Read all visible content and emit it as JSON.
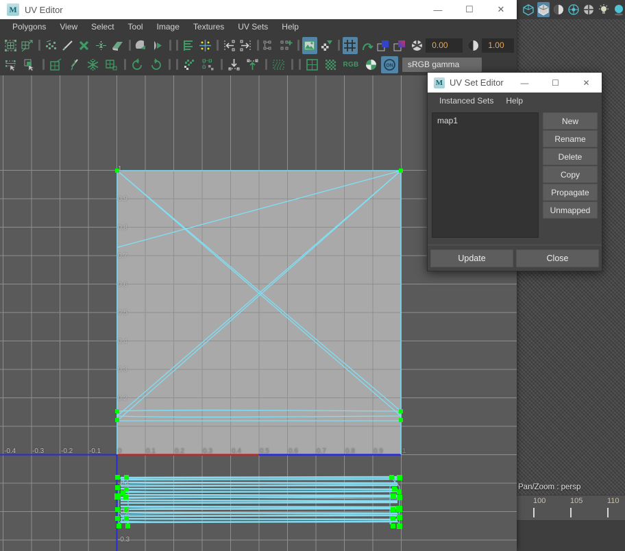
{
  "window": {
    "title": "UV Editor",
    "logo_letter": "M",
    "minimize": "—",
    "maximize": "☐",
    "close": "✕"
  },
  "menubar": {
    "items": [
      "Polygons",
      "View",
      "Select",
      "Tool",
      "Image",
      "Textures",
      "UV Sets",
      "Help"
    ]
  },
  "toolbar": {
    "row1_icons": [
      "uv-lattice-icon",
      "uv-grid-move-icon",
      "sep",
      "uv-smooth-icon",
      "uv-cut-tool-icon",
      "uv-cut-x-icon",
      "uv-sew-icon",
      "uv-unfold-icon",
      "sep",
      "uv-flip-icon",
      "uv-rotate-shell-icon",
      "sep",
      "uv-align-stack-icon",
      "uv-snap-together-icon",
      "sep",
      "uv-align-left-icon",
      "uv-align-right-icon"
    ],
    "row2_icons": [
      "uv-select-shell-icon",
      "uv-select-face-icon",
      "sep",
      "uv-create-icon",
      "uv-cut-uv-icon",
      "uv-unfold-snowflake-icon",
      "uv-layout-icon",
      "sep",
      "uv-undo-icon",
      "uv-redo-icon",
      "sep",
      "uv-distribute-icon",
      "uv-grid-arrange-icon",
      "sep",
      "uv-align-bottom-icon",
      "uv-align-top-icon"
    ],
    "display_toggle_icon": "image-display-icon",
    "checker_icon": "checker-filter-icon",
    "dim_image_icon": "dim-image-icon",
    "grid_icon": "uv-grid-icon",
    "distort_icon": "distortion-icon",
    "blue_swatch_icon": "solid-color-swatch-icon",
    "gradient_swatch_icon": "gradient-swatch-icon",
    "aperture_icon": "exposure-icon",
    "exposure_value": "0.00",
    "contrast_icon": "gamma-icon",
    "gamma_value": "1.00",
    "uv_border_icon": "uv-border-icon",
    "checker_pattern_icon": "checker-pattern-icon",
    "rgb_label": "RGB",
    "channel_icon": "channel-pie-icon",
    "on_toggle_icon": "on-toggle-icon",
    "color_space": "sRGB gamma"
  },
  "uv_set_editor": {
    "title": "UV Set Editor",
    "logo_letter": "M",
    "minimize": "—",
    "maximize": "☐",
    "close": "✕",
    "menu": [
      "Instanced Sets",
      "Help"
    ],
    "sets": [
      "map1"
    ],
    "side_buttons": [
      "New",
      "Rename",
      "Delete",
      "Copy",
      "Propagate",
      "Unmapped"
    ],
    "footer_buttons": [
      "Update",
      "Close"
    ]
  },
  "uv_canvas": {
    "u_ticks": [
      "0",
      "0.1",
      "0.2",
      "0.3",
      "0.4",
      "0.5",
      "0.6",
      "0.7",
      "0.8",
      "0.9",
      "1"
    ],
    "u_ticks_left": [
      "-0.4",
      "-0.3",
      "-0.2",
      "-0.1"
    ],
    "v_ticks_up": [
      "0.2",
      "0.3",
      "0.4",
      "0.5",
      "0.6",
      "0.7",
      "0.8",
      "0.9",
      "1"
    ],
    "v_ticks_down": [
      "-0.1",
      "-0.2",
      "-0.3"
    ],
    "colors": {
      "tile_fill": "#a9a9a9",
      "background": "#5a5a5a",
      "grid": "#8f8f8f",
      "uv_edge": "#6fd8f2",
      "uv_vertex": "#00ff00",
      "u_axis": "#cc2222",
      "v_axis": "#2222dd"
    }
  },
  "viewport": {
    "pan_zoom_label": "Pan/Zoom : persp",
    "timeline_ticks": [
      "100",
      "105",
      "110"
    ],
    "icons": [
      "shaded-cube-icon",
      "textured-cube-icon",
      "contrast-sphere-icon",
      "xray-joint-icon",
      "checker-sphere-icon",
      "light-bulb-icon",
      "shadow-sphere-icon"
    ]
  }
}
